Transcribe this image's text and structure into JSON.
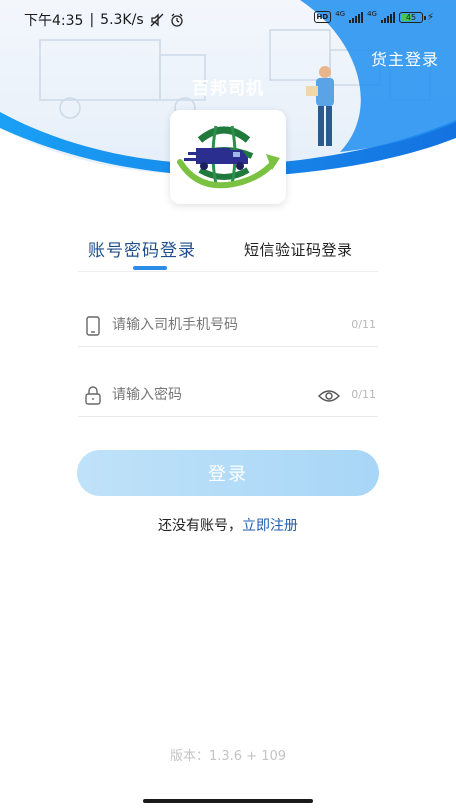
{
  "status_bar": {
    "time": "下午4:35",
    "separator": "|",
    "net_speed": "5.3K/s",
    "hd_label": "HD",
    "net_label_1": "4G",
    "net_label_2": "4G",
    "battery_level": "45"
  },
  "header": {
    "shipper_login": "货主登录",
    "app_title": "百邦司机"
  },
  "tabs": {
    "active": "账号密码登录",
    "inactive": "短信验证码登录"
  },
  "phone_field": {
    "placeholder": "请输入司机手机号码",
    "value": "",
    "counter": "0/11"
  },
  "password_field": {
    "placeholder": "请输入密码",
    "value": "",
    "counter": "0/11"
  },
  "login_button": {
    "label": "登录"
  },
  "register": {
    "prompt": "还没有账号，",
    "link": "立即注册"
  },
  "version": {
    "text": "版本：1.3.6 + 109"
  },
  "colors": {
    "brand_blue": "#1e8ef0",
    "tab_active": "#1f4e8c",
    "tab_indicator": "#2c8de8",
    "login_button": "#a8d6f6",
    "register_link": "#1f5fae"
  },
  "icons": {
    "phone": "phone-icon",
    "lock": "lock-icon",
    "eye": "eye-icon",
    "mute": "mute-icon",
    "alarm": "alarm-icon",
    "signal": "signal-icon",
    "battery": "battery-icon",
    "logo": "app-logo"
  }
}
